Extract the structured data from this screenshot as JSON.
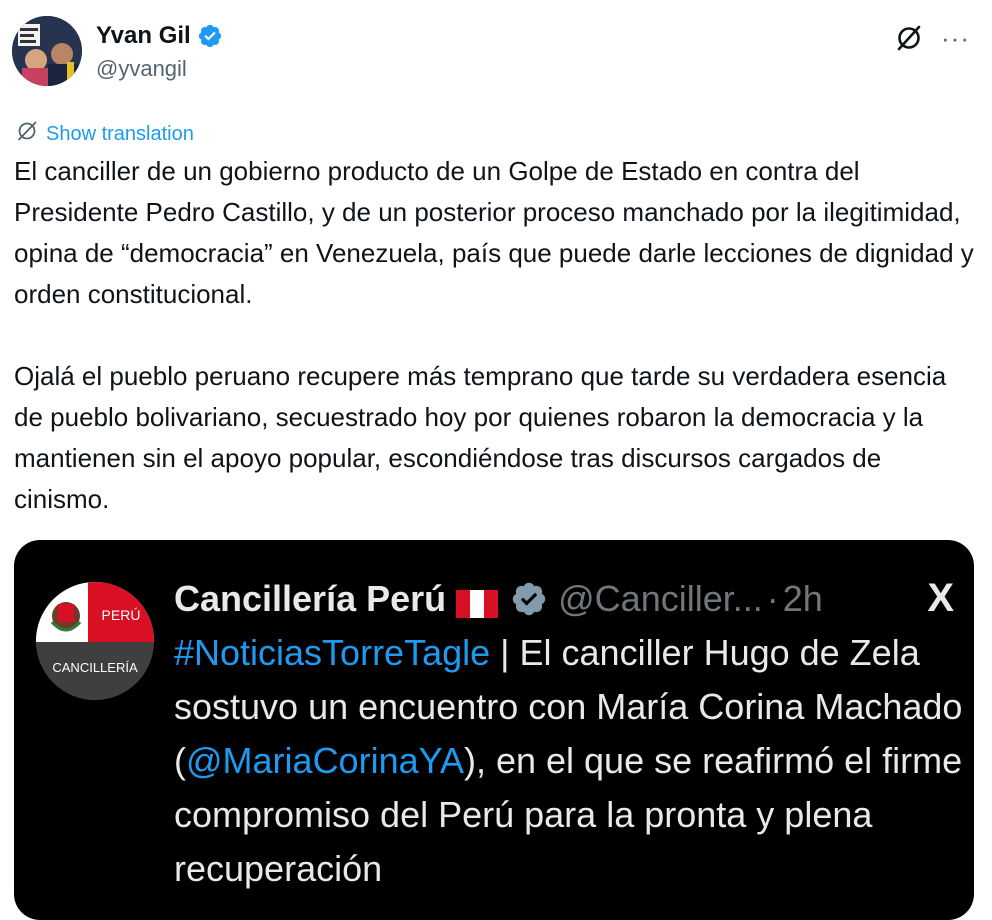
{
  "author": {
    "name": "Yvan Gil",
    "handle": "@yvangil"
  },
  "actions": {
    "translate_label": "Show translation",
    "more_label": "···"
  },
  "tweet": {
    "paragraphs": [
      "El canciller de un gobierno producto de un Golpe de Estado en contra del Presidente Pedro Castillo, y de un posterior proceso manchado por la ilegitimidad, opina de “democracia” en Venezuela, país que puede darle lecciones de dignidad y orden constitucional.",
      "Ojalá el pueblo peruano recupere más temprano que tarde su verdadera esencia de pueblo bolivariano, secuestrado hoy por quienes robaron la democracia y la mantienen sin el apoyo popular, escondiéndose tras discursos cargados de cinismo."
    ]
  },
  "quoted": {
    "avatar_label_top": "PERÚ",
    "avatar_label_bottom": "CANCILLERÍA",
    "name": "Cancillería Perú",
    "handle": "@Canciller...",
    "separator": "·",
    "time": "2h",
    "x_logo": "X",
    "hashtag": "#NoticiasTorreTagle",
    "text_part1": " | El canciller Hugo de Zela sostuvo un encuentro con María Corina Machado (",
    "mention": "@MariaCorinaYA",
    "text_part2": "), en el que se reafirmó el firme compromiso del Perú para la pronta y plena recuperación"
  },
  "colors": {
    "accent": "#1d9bf0",
    "text": "#0f1419",
    "muted": "#536471",
    "quote_bg": "#000000",
    "peru_red": "#d91023"
  }
}
